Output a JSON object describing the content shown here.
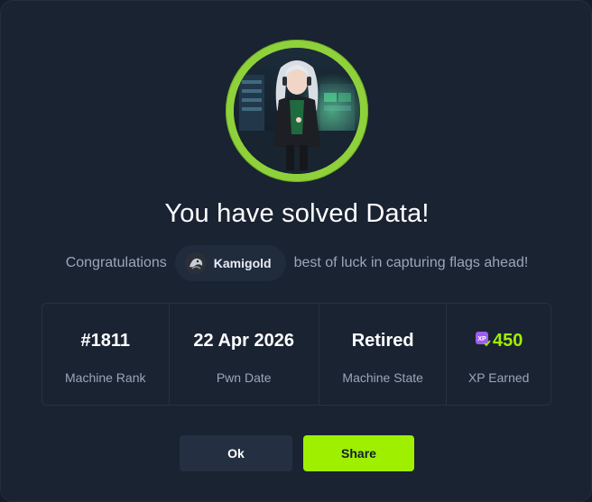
{
  "modal": {
    "title": "You have solved Data!",
    "congrats_prefix": "Congratulations",
    "username": "Kamigold",
    "congrats_suffix": "best of luck in capturing flags ahead!",
    "machine_avatar_icon": "machine-avatar-icon",
    "user_avatar_icon": "user-avatar-icon"
  },
  "stats": [
    {
      "value": "#1811",
      "label": "Machine Rank"
    },
    {
      "value": "22 Apr 2026",
      "label": "Pwn Date"
    },
    {
      "value": "Retired",
      "label": "Machine State"
    },
    {
      "value": "450",
      "label": "XP Earned",
      "icon": "xp-icon"
    }
  ],
  "buttons": {
    "ok_label": "Ok",
    "share_label": "Share"
  },
  "colors": {
    "accent_green": "#9fef00",
    "ring_green": "#8fd13a",
    "background": "#1a2332",
    "xp_badge": "#9f5cf2"
  }
}
